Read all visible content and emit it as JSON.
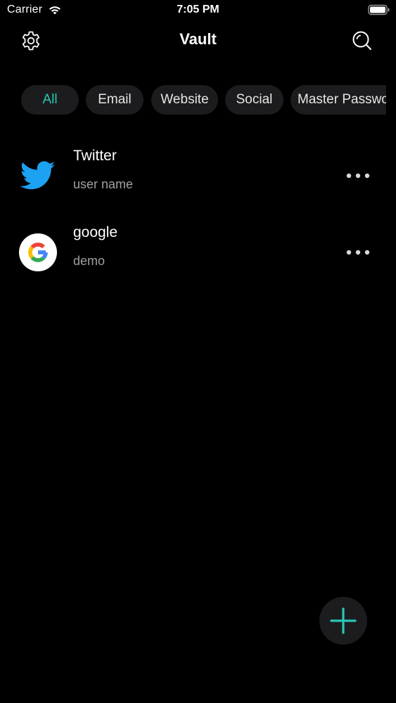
{
  "status_bar": {
    "carrier": "Carrier",
    "time": "7:05 PM"
  },
  "header": {
    "title": "Vault",
    "left_icon": "gear-icon",
    "right_icon": "search-icon"
  },
  "filters": {
    "selected": "All",
    "chips": [
      "All",
      "Email",
      "Website",
      "Social",
      "Master Password"
    ]
  },
  "accounts": [
    {
      "name": "Twitter",
      "username": "user name",
      "icon": "twitter-logo-icon"
    },
    {
      "name": "google",
      "username": "demo",
      "icon": "google-logo-icon"
    }
  ],
  "colors": {
    "background": "#000000",
    "accent": "#29c7b6",
    "surface": "#1c1c1e",
    "secondary_text": "#a0a0a5",
    "twitter_blue": "#1da1f2"
  },
  "fab": {
    "icon": "plus-icon"
  }
}
